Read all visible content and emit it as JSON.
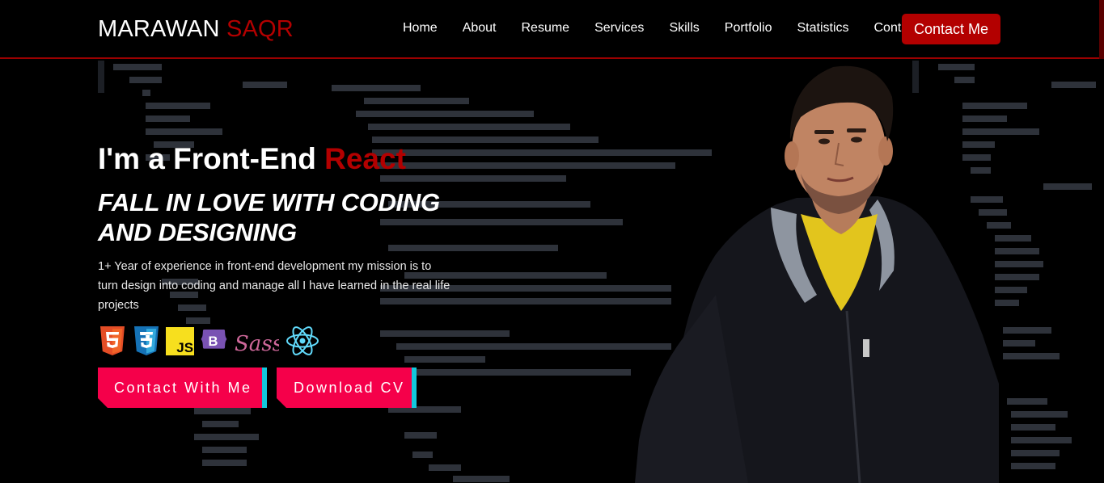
{
  "brand": {
    "first": "MARAWAN",
    "last": "SAQR"
  },
  "nav": {
    "links": [
      "Home",
      "About",
      "Resume",
      "Services",
      "Skills",
      "Portfolio",
      "Statistics",
      "Contact"
    ],
    "cta": "Contact Me"
  },
  "hero": {
    "title_prefix": "I'm a Front-End ",
    "title_accent": "React",
    "subtitle": "FALL IN LOVE WITH CODING AND DESIGNING",
    "description": "1+ Year of experience in front-end development my mission is to turn design into coding and manage all I have learned in the real life projects",
    "tech_icons": [
      "html5-icon",
      "css3-icon",
      "javascript-icon",
      "bootstrap-icon",
      "sass-icon",
      "react-icon"
    ],
    "buttons": {
      "contact": "Contact With Me",
      "download": "Download CV"
    }
  },
  "colors": {
    "accent": "#b30000",
    "button": "#f5004a",
    "button_edge": "#12c8dc",
    "background": "#000000"
  }
}
